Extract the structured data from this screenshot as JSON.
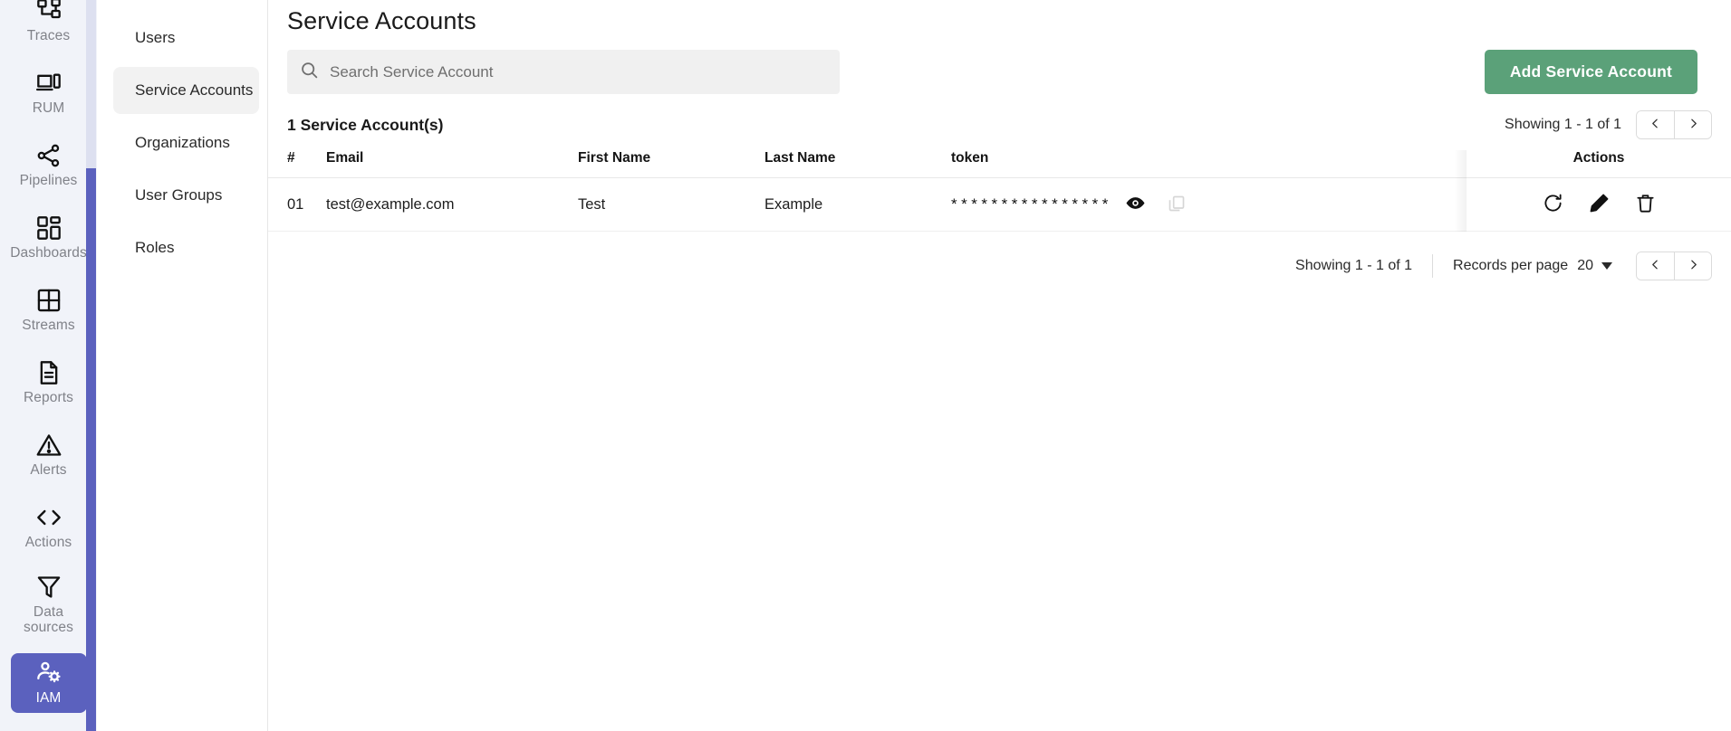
{
  "rail": {
    "items": [
      {
        "label": "Traces",
        "icon": "traces-icon",
        "active": false
      },
      {
        "label": "RUM",
        "icon": "rum-icon",
        "active": false
      },
      {
        "label": "Pipelines",
        "icon": "pipelines-icon",
        "active": false
      },
      {
        "label": "Dashboards",
        "icon": "dashboards-icon",
        "active": false
      },
      {
        "label": "Streams",
        "icon": "streams-icon",
        "active": false
      },
      {
        "label": "Reports",
        "icon": "reports-icon",
        "active": false
      },
      {
        "label": "Alerts",
        "icon": "alerts-icon",
        "active": false
      },
      {
        "label": "Actions",
        "icon": "actions-icon",
        "active": false
      },
      {
        "label": "Data sources",
        "icon": "data-sources-icon",
        "active": false
      },
      {
        "label": "IAM",
        "icon": "iam-icon",
        "active": true
      }
    ],
    "active_color": "#5B61BE",
    "background": "#F1F3F9",
    "label_color": "#808289",
    "scrollbar_track": "#DDE0F0",
    "scrollbar_thumb": "#5B61BE"
  },
  "subnav": {
    "items": [
      {
        "label": "Users",
        "active": false
      },
      {
        "label": "Service Accounts",
        "active": true
      },
      {
        "label": "Organizations",
        "active": false
      },
      {
        "label": "User Groups",
        "active": false
      },
      {
        "label": "Roles",
        "active": false
      }
    ],
    "active_background": "#F2F2F2"
  },
  "header": {
    "title": "Service Accounts"
  },
  "search": {
    "placeholder": "Search Service Account",
    "value": "",
    "icon": "search-icon",
    "background": "#F0F0F0"
  },
  "toolbar": {
    "add_label": "Add Service Account",
    "add_color": "#5BA179"
  },
  "list": {
    "count_label": "1 Service Account(s)",
    "top_pagination": {
      "showing": "Showing 1 - 1 of 1",
      "prev_icon": "chevron-left-icon",
      "next_icon": "chevron-right-icon"
    }
  },
  "table": {
    "columns": [
      {
        "key": "num",
        "label": "#"
      },
      {
        "key": "email",
        "label": "Email"
      },
      {
        "key": "first",
        "label": "First Name"
      },
      {
        "key": "last",
        "label": "Last Name"
      },
      {
        "key": "token",
        "label": "token"
      },
      {
        "key": "act",
        "label": "Actions"
      }
    ],
    "rows": [
      {
        "num": "01",
        "email": "test@example.com",
        "first": "Test",
        "last": "Example",
        "token_mask": "****************",
        "token_visible": false,
        "reveal_icon": "eye-icon",
        "copy_icon": "copy-icon",
        "actions": [
          {
            "name": "refresh-token-button",
            "icon": "refresh-icon"
          },
          {
            "name": "edit-button",
            "icon": "pencil-icon"
          },
          {
            "name": "delete-button",
            "icon": "trash-icon"
          }
        ]
      }
    ]
  },
  "bottom_pagination": {
    "showing": "Showing 1 - 1 of 1",
    "records_per_page_label": "Records per page",
    "records_per_page_value": "20",
    "caret_icon": "chevron-down-icon",
    "prev_icon": "chevron-left-icon",
    "next_icon": "chevron-right-icon"
  }
}
